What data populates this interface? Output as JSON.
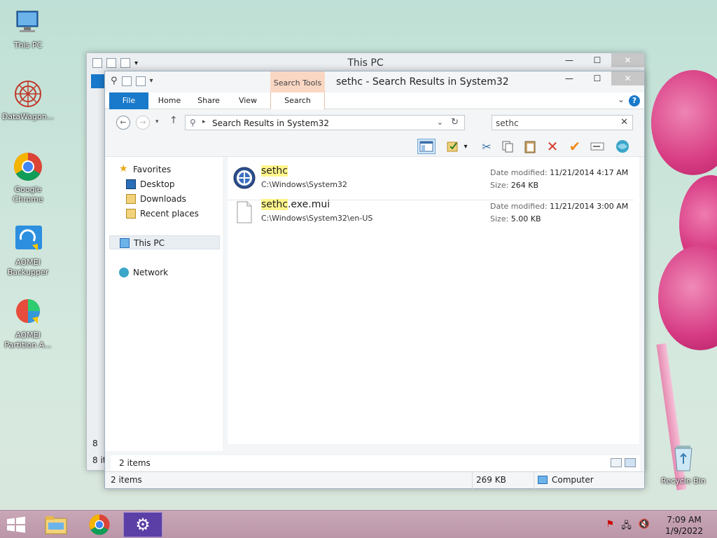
{
  "desktop": {
    "icons": [
      {
        "label": "This PC"
      },
      {
        "label": "DataWagon..."
      },
      {
        "label": "Google Chrome"
      },
      {
        "label": "AOMEI Backupper"
      },
      {
        "label": "AOMEI Partition A..."
      },
      {
        "label": "Recycle Bin"
      }
    ]
  },
  "back_window": {
    "title": "This PC",
    "minimize": "—",
    "maximize": "☐",
    "close": "✕",
    "left_edge_char": "8",
    "left_edge_status": "8 it"
  },
  "window": {
    "title": "sethc - Search Results in System32",
    "contextual_tab_header": "Search Tools",
    "minimize": "—",
    "maximize": "☐",
    "close": "✕",
    "ribbon_tabs": {
      "file": "File",
      "home": "Home",
      "share": "Share",
      "view": "View",
      "search": "Search"
    },
    "help": "?",
    "address": {
      "path": "Search Results in System32",
      "chevron": "▸"
    },
    "search": {
      "value": "sethc",
      "clear": "✕"
    },
    "nav": {
      "favorites": "Favorites",
      "desktop": "Desktop",
      "downloads": "Downloads",
      "recent_places": "Recent places",
      "this_pc": "This PC",
      "network": "Network"
    },
    "results": [
      {
        "name_highlight": "sethc",
        "name_rest": "",
        "path": "C:\\Windows\\System32",
        "date_label": "Date modified:",
        "date_value": "11/21/2014 4:17 AM",
        "size_label": "Size:",
        "size_value": "264 KB"
      },
      {
        "name_highlight": "sethc",
        "name_rest": ".exe.mui",
        "path": "C:\\Windows\\System32\\en-US",
        "date_label": "Date modified:",
        "date_value": "11/21/2014 3:00 AM",
        "size_label": "Size:",
        "size_value": "5.00 KB"
      }
    ],
    "status_items": "2 items",
    "details_bar": {
      "items": "2 items",
      "size": "269 KB",
      "location": "Computer"
    }
  },
  "taskbar": {
    "clock_time": "7:09 AM",
    "clock_date": "1/9/2022"
  },
  "colors": {
    "accent": "#1979ca",
    "highlight": "#fff58b",
    "context_tab": "#f9d7c3",
    "taskbar": "#c9a7b6"
  }
}
